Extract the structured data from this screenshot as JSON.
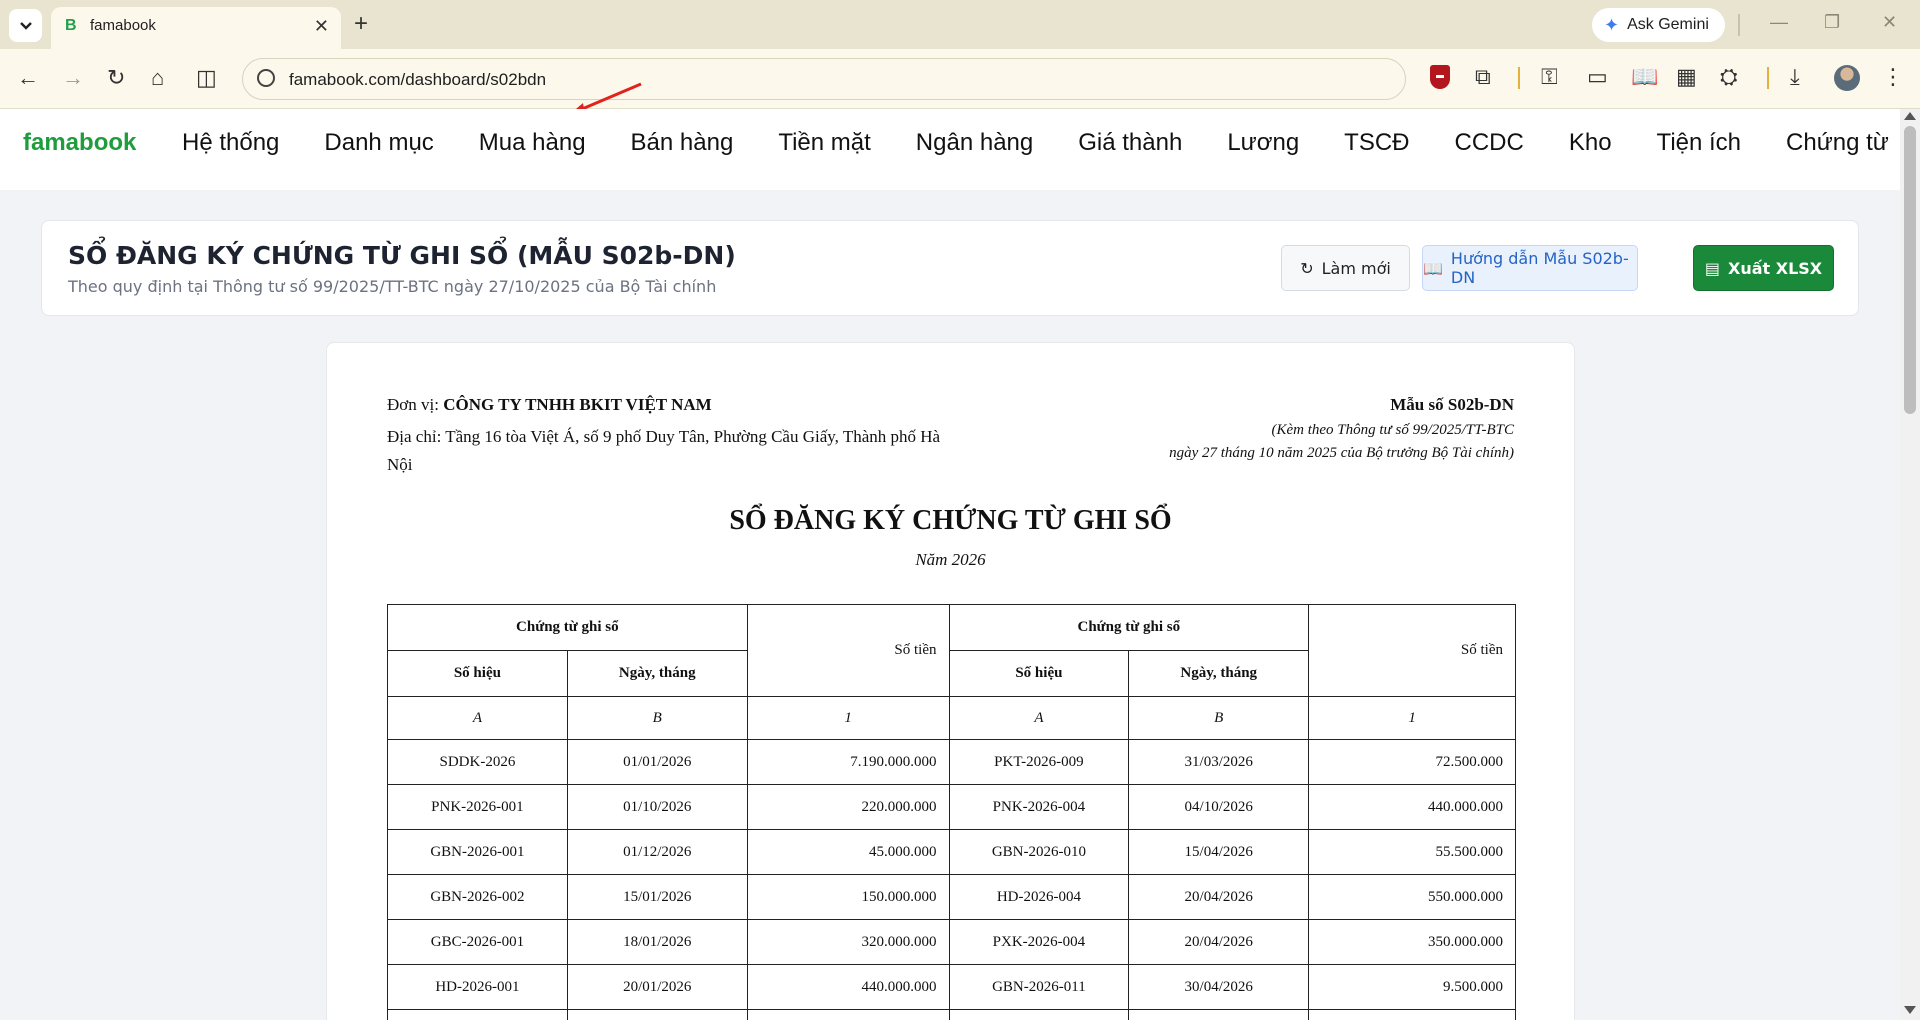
{
  "browser": {
    "tab_title": "famabook",
    "tab_favicon": "B",
    "gemini_label": "Ask Gemini",
    "url": "famabook.com/dashboard/s02bdn"
  },
  "app": {
    "brand": "famabook",
    "menu": [
      "Hệ thống",
      "Danh mục",
      "Mua hàng",
      "Bán hàng",
      "Tiền mặt",
      "Ngân hàng",
      "Giá thành",
      "Lương",
      "TSCĐ",
      "CCDC",
      "Kho",
      "Tiện ích",
      "Chứng từ"
    ]
  },
  "header": {
    "title": "SỔ ĐĂNG KÝ CHỨNG TỪ GHI SỔ (MẪU S02b-DN)",
    "subtitle": "Theo quy định tại Thông tư số 99/2025/TT-BTC ngày 27/10/2025 của Bộ Tài chính",
    "refresh_label": "Làm mới",
    "guide_label": "Hướng dẫn Mẫu S02b-DN",
    "export_label": "Xuất XLSX"
  },
  "document": {
    "unit_label": "Đơn vị:",
    "unit_name": "CÔNG TY TNHH BKIT VIỆT NAM",
    "address": "Địa chỉ: Tầng 16 tòa Việt Á, số 9 phố Duy Tân, Phường Cầu Giấy, Thành phố Hà Nội",
    "form_no": "Mẫu số S02b-DN",
    "form_note_1": "(Kèm theo Thông tư số 99/2025/TT-BTC",
    "form_note_2": "ngày 27 tháng 10 năm 2025 của Bộ trưởng Bộ Tài chính)",
    "title": "SỔ ĐĂNG KÝ CHỨNG TỪ GHI SỔ",
    "year": "Năm 2026"
  },
  "table": {
    "group_header": "Chứng từ ghi sổ",
    "amount_header": "Số tiền",
    "col_no": "Số hiệu",
    "col_date": "Ngày, tháng",
    "idx": [
      "A",
      "B",
      "1",
      "A",
      "B",
      "1"
    ],
    "rows": [
      [
        "SDDK-2026",
        "01/01/2026",
        "7.190.000.000",
        "PKT-2026-009",
        "31/03/2026",
        "72.500.000"
      ],
      [
        "PNK-2026-001",
        "01/10/2026",
        "220.000.000",
        "PNK-2026-004",
        "04/10/2026",
        "440.000.000"
      ],
      [
        "GBN-2026-001",
        "01/12/2026",
        "45.000.000",
        "GBN-2026-010",
        "15/04/2026",
        "55.500.000"
      ],
      [
        "GBN-2026-002",
        "15/01/2026",
        "150.000.000",
        "HD-2026-004",
        "20/04/2026",
        "550.000.000"
      ],
      [
        "GBC-2026-001",
        "18/01/2026",
        "320.000.000",
        "PXK-2026-004",
        "20/04/2026",
        "350.000.000"
      ],
      [
        "HD-2026-001",
        "20/01/2026",
        "440.000.000",
        "GBN-2026-011",
        "30/04/2026",
        "9.500.000"
      ],
      [
        "",
        "",
        "",
        "",
        "",
        ""
      ]
    ]
  }
}
